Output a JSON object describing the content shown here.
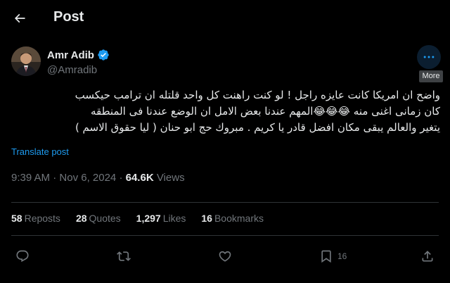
{
  "header": {
    "title": "Post",
    "back_icon": "arrow-left-icon"
  },
  "author": {
    "name": "Amr Adib",
    "handle": "@Amradib",
    "verified": true,
    "verified_color": "#1d9bf0"
  },
  "more": {
    "icon": "more-dots-icon",
    "tooltip": "More"
  },
  "tweet": {
    "lines": [
      "واضح ان امريكا كانت عايزه راجل ! لو كنت راهنت كل واحد قلتله ان ترامب حيكسب",
      "كان زمانى اغنى منه 😂😂😂المهم عندنا بعض الامل ان الوضع عندنا فى المنطقه",
      "يتغير والعالم يبقى مكان افضل قادر يا كريم . مبروك حج ابو حنان ( ليا حقوق الاسم )"
    ],
    "translate": "Translate post"
  },
  "meta": {
    "time": "9:39 AM",
    "separator": "·",
    "date": "Nov 6, 2024",
    "views_count": "64.6K",
    "views_label": "Views"
  },
  "stats": {
    "reposts_count": "58",
    "reposts_label": "Reposts",
    "quotes_count": "28",
    "quotes_label": "Quotes",
    "likes_count": "1,297",
    "likes_label": "Likes",
    "bookmarks_count": "16",
    "bookmarks_label": "Bookmarks"
  },
  "actions": {
    "reply_icon": "reply-icon",
    "repost_icon": "repost-icon",
    "like_icon": "heart-icon",
    "bookmark_icon": "bookmark-icon",
    "bookmark_count": "16",
    "share_icon": "share-icon"
  },
  "colors": {
    "background": "#000000",
    "text": "#e7e9ea",
    "secondary": "#71767b",
    "accent": "#1d9bf0",
    "divider": "#2f3336"
  }
}
